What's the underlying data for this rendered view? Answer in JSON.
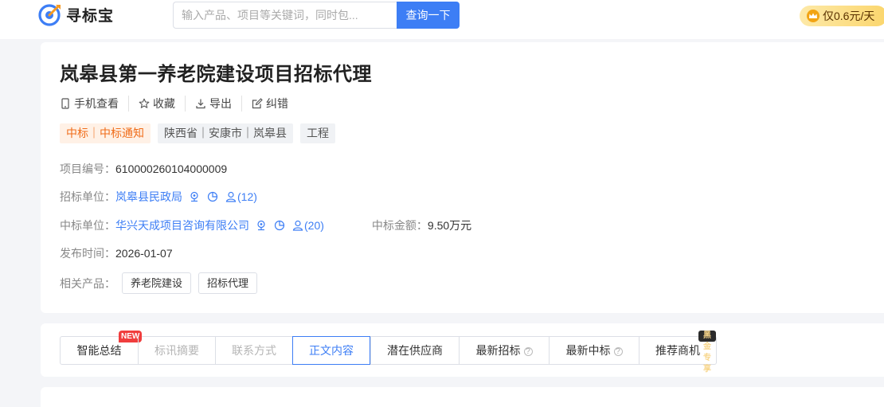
{
  "header": {
    "logo_text": "寻标宝",
    "search_placeholder": "输入产品、项目等关键词，同时包...",
    "search_button": "查询一下",
    "price_badge": "仅0.6元/天"
  },
  "detail": {
    "title": "岚皋县第一养老院建设项目招标代理",
    "actions": [
      {
        "label": "手机查看"
      },
      {
        "label": "收藏"
      },
      {
        "label": "导出"
      },
      {
        "label": "纠错"
      }
    ],
    "tags": [
      "中标｜中标通知",
      "陕西省｜安康市｜岚皋县",
      "工程"
    ],
    "project_no_label": "项目编号：",
    "project_no": "610000260104000009",
    "tenderer_label": "招标单位：",
    "tenderer": "岚皋县民政局",
    "tenderer_count": "(12)",
    "winner_label": "中标单位：",
    "winner": "华兴天成项目咨询有限公司",
    "winner_count": "(20)",
    "amount_label": "中标金额：",
    "amount": "9.50万元",
    "publish_label": "发布时间：",
    "publish_date": "2026-01-07",
    "products_label": "相关产品：",
    "products": [
      "养老院建设",
      "招标代理"
    ]
  },
  "tabs": [
    {
      "label": "智能总结",
      "badge": "NEW"
    },
    {
      "label": "标讯摘要"
    },
    {
      "label": "联系方式"
    },
    {
      "label": "正文内容"
    },
    {
      "label": "潜在供应商"
    },
    {
      "label": "最新招标",
      "help": "?"
    },
    {
      "label": "最新中标",
      "help": "?"
    },
    {
      "label": "推荐商机",
      "badge": "黑金专享"
    }
  ],
  "content_heading": "",
  "colors": {
    "accent": "#3d7ef5",
    "tag_orange": "#f06d1a",
    "badge_new": "#f03d3d"
  }
}
